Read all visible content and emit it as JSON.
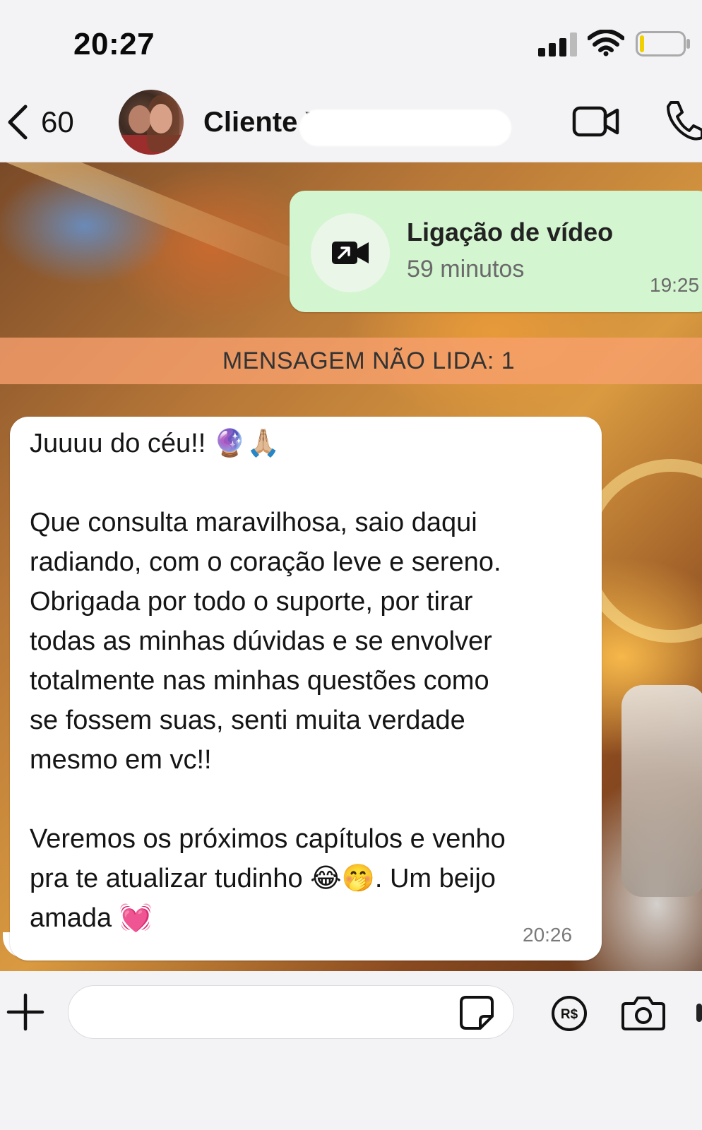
{
  "status_bar": {
    "time": "20:27",
    "signal_icon": "cellular-signal-icon",
    "wifi_icon": "wifi-icon",
    "battery_icon": "battery-low-icon"
  },
  "header": {
    "back_count": "60",
    "contact_name_visible": "Cliente Ya",
    "video_call_icon": "video-camera-icon",
    "voice_call_icon": "phone-icon"
  },
  "messages": {
    "call": {
      "title": "Ligação de vídeo",
      "duration": "59 minutos",
      "time": "19:25",
      "icon": "outgoing-video-call-icon"
    },
    "unread_banner": "MENSAGEM NÃO LIDA: 1",
    "incoming": {
      "lines": [
        "Juuuu do céu!! 🔮🙏🏼",
        "",
        "Que consulta maravilhosa, saio daqui",
        "radiando, com o coração leve e sereno.",
        "Obrigada por todo o suporte, por tirar",
        "todas as minhas dúvidas e se envolver",
        "totalmente nas minhas questões como",
        "se fossem suas, senti muita verdade",
        "mesmo em vc!!",
        "",
        "Veremos os próximos capítulos e venho",
        "pra te atualizar tudinho 😂🤭. Um beijo",
        "amada 💓"
      ],
      "time": "20:26"
    }
  },
  "input_bar": {
    "plus_icon": "plus-icon",
    "message_value": "",
    "sticker_icon": "sticker-icon",
    "payment_icon": "brl-payment-icon",
    "payment_symbol": "R$",
    "camera_icon": "camera-icon"
  },
  "colors": {
    "call_bubble": "#d3f5d0",
    "unread_banner": "#f8a06e",
    "incoming_bubble": "#ffffff",
    "header_bg": "#f3f3f5"
  }
}
